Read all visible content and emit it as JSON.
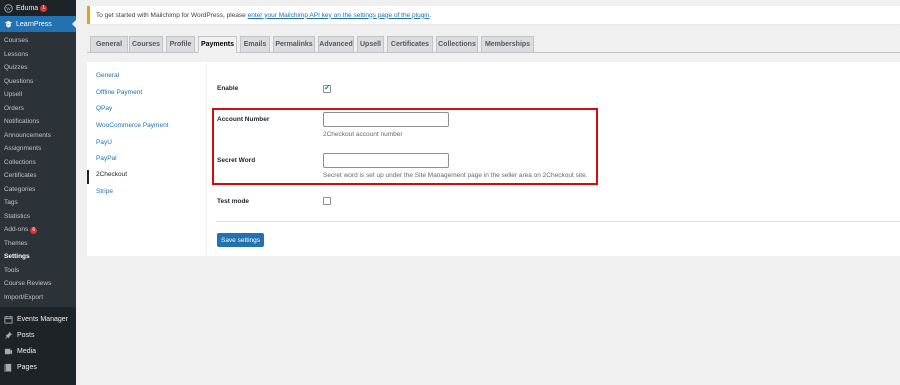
{
  "sidebar": {
    "site_name": "Eduma",
    "site_badge": "1",
    "active_plugin": "LearnPress",
    "submenu": [
      "Courses",
      "Lessons",
      "Quizzes",
      "Questions",
      "Upsell",
      "Orders",
      "Notifications",
      "Announcements",
      "Assignments",
      "Collections",
      "Certificates",
      "Categories",
      "Tags",
      "Statistics",
      "Add-ons",
      "Themes",
      "Settings",
      "Tools",
      "Course Reviews",
      "Import/Export"
    ],
    "addons_badge": "6",
    "current_submenu": "Settings",
    "main_items": [
      {
        "label": "Events Manager",
        "icon": "calendar-icon"
      },
      {
        "label": "Posts",
        "icon": "pin-icon"
      },
      {
        "label": "Media",
        "icon": "media-icon"
      },
      {
        "label": "Pages",
        "icon": "page-icon"
      }
    ]
  },
  "notice": {
    "text": "To get started with Mailchimp for WordPress, please ",
    "link_text": "enter your Mailchimp API key on the settings page of the plugin",
    "suffix": "."
  },
  "tabs": [
    "General",
    "Courses",
    "Profile",
    "Payments",
    "Emails",
    "Permalinks",
    "Advanced",
    "Upsell",
    "Certificates",
    "Collections",
    "Memberships"
  ],
  "active_tab": "Payments",
  "subnav": [
    "General",
    "Offline Payment",
    "QPay",
    "WooCommerce Payment",
    "PayU",
    "PayPal",
    "2Checkout",
    "Stripe"
  ],
  "current_subnav": "2Checkout",
  "form": {
    "enable_label": "Enable",
    "enable_checked": true,
    "account_label": "Account Number",
    "account_value": "",
    "account_desc": "2Checkout account number",
    "secret_label": "Secret Word",
    "secret_value": "",
    "secret_desc": "Secret word is set up under the Site Management page in the seller area on 2Checkout site.",
    "test_label": "Test mode",
    "test_checked": false,
    "save_label": "Save settings"
  },
  "colors": {
    "accent": "#2271b1",
    "highlight": "#d40c0c",
    "notice_border": "#dba617",
    "sidebar_bg": "#1d2327"
  }
}
